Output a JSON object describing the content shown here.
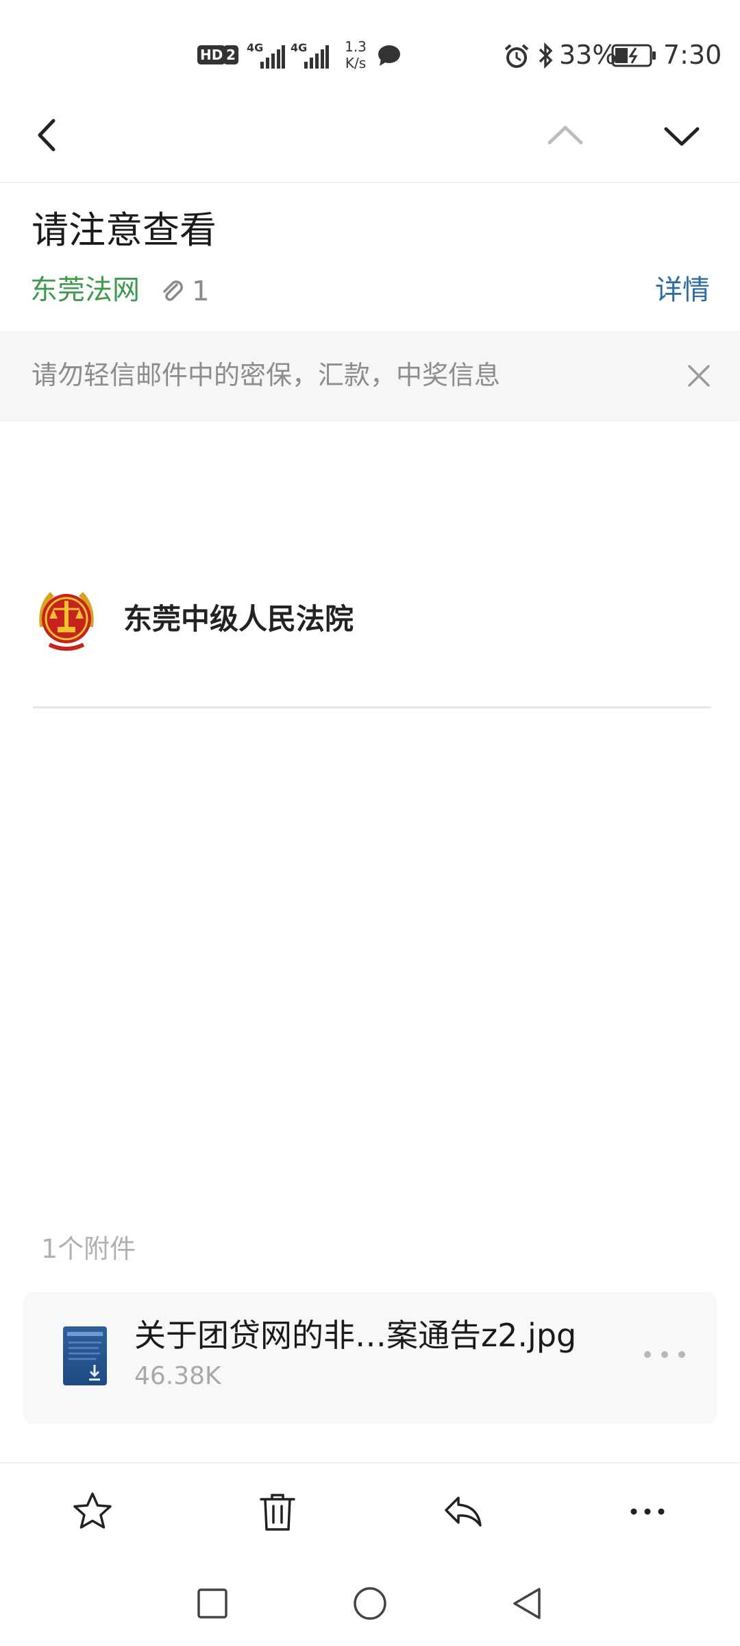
{
  "status_bar": {
    "hd": "HD",
    "sim": "2",
    "network_1": "4G",
    "network_2": "4G",
    "speed_value": "1.3",
    "speed_unit": "K/s",
    "battery": "33%",
    "time": "7:30"
  },
  "email": {
    "subject": "请注意查看",
    "sender": "东莞法网",
    "attachment_count": "1",
    "details_label": "详情"
  },
  "warning": {
    "text": "请勿轻信邮件中的密保，汇款，中奖信息"
  },
  "body": {
    "organization": "东莞中级人民法院"
  },
  "attachments": {
    "header": "1个附件",
    "items": [
      {
        "name": "关于团贷网的非…案通告z2.jpg",
        "size": "46.38K"
      }
    ]
  },
  "colors": {
    "sender": "#3d9a4b",
    "details": "#2b6ca3",
    "warning_bg": "#f5f6f8"
  }
}
